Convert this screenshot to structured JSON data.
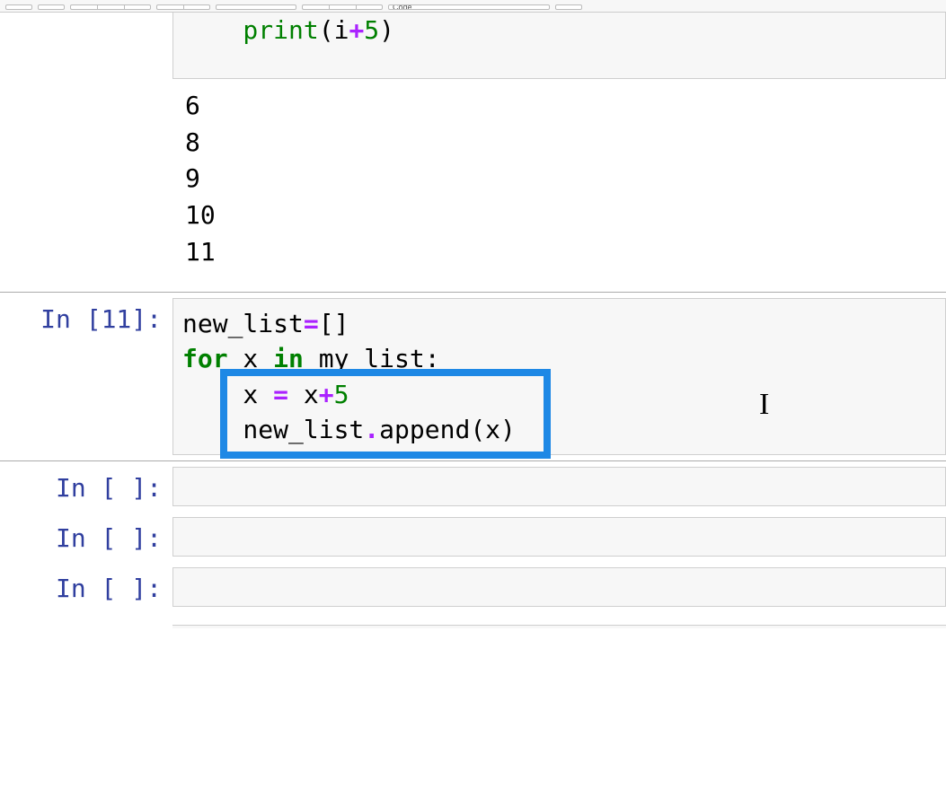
{
  "toolbar": {
    "cell_type_selected": "Code"
  },
  "cells": {
    "partial_top": {
      "line": "    print(i+5)"
    },
    "output_top": {
      "lines": [
        "6",
        "8",
        "9",
        "10",
        "11"
      ]
    },
    "cell1": {
      "prompt": "In [11]:",
      "code_lines": [
        "new_list=[]",
        "for x in my_list:",
        "    x = x+5",
        "    new_list.append(x)"
      ]
    },
    "cell2": {
      "prompt": "In [ ]:"
    },
    "cell3": {
      "prompt": "In [ ]:"
    },
    "cell4": {
      "prompt": "In [ ]:"
    }
  },
  "colors": {
    "keyword": "#008000",
    "operator": "#AA22FF",
    "prompt_in": "#303F9F",
    "highlight": "#1E88E5"
  }
}
